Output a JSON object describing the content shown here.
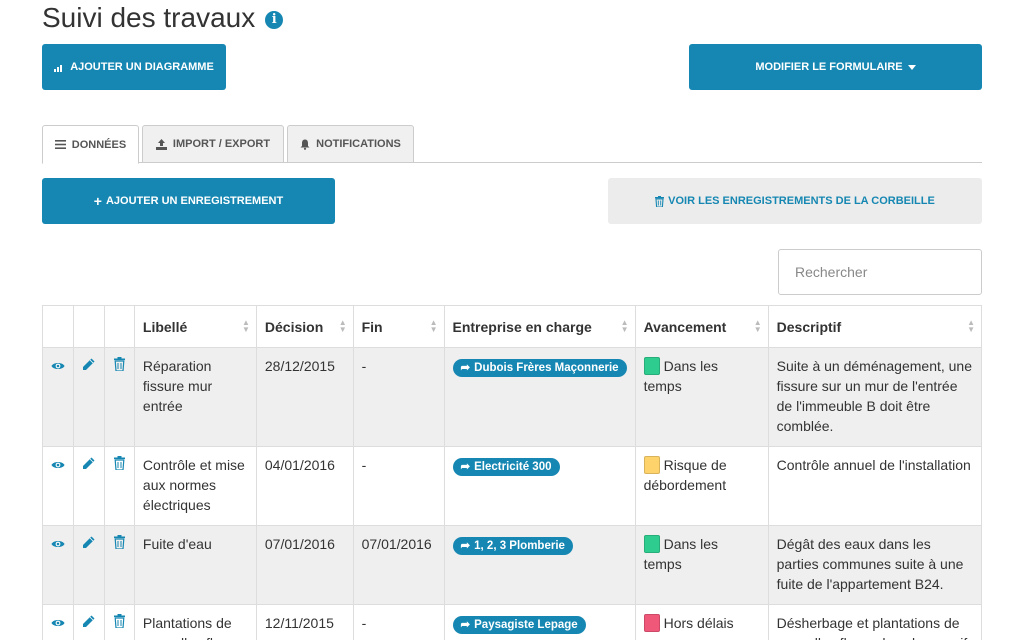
{
  "page": {
    "title": "Suivi des travaux"
  },
  "toolbar": {
    "add_chart_label": "AJOUTER UN DIAGRAMME",
    "edit_form_label": "MODIFIER LE FORMULAIRE"
  },
  "tabs": [
    {
      "label": "DONNÉES",
      "icon": "list-icon",
      "active": true
    },
    {
      "label": "IMPORT / EXPORT",
      "icon": "import-export-icon",
      "active": false
    },
    {
      "label": "NOTIFICATIONS",
      "icon": "bell-icon",
      "active": false
    }
  ],
  "actions": {
    "add_record_label": "AJOUTER UN ENREGISTREMENT",
    "trash_label": "VOIR LES ENREGISTREMENTS DE LA CORBEILLE"
  },
  "search": {
    "placeholder": "Rechercher"
  },
  "colors": {
    "accent": "#1687b2",
    "status_green": "#2ecc8f",
    "status_yellow": "#ffd36b",
    "status_red": "#f0587a"
  },
  "table": {
    "columns": [
      "Libellé",
      "Décision",
      "Fin",
      "Entreprise en charge",
      "Avancement",
      "Descriptif"
    ],
    "rows": [
      {
        "libelle": "Réparation fissure mur entrée",
        "decision": "28/12/2015",
        "fin": "-",
        "entreprise": "Dubois Frères Maçonnerie",
        "avancement": "Dans les temps",
        "status_color": "#2ecc8f",
        "descriptif": "Suite à un déménagement, une fissure sur un mur de l'entrée de l'immeuble B doit être comblée."
      },
      {
        "libelle": "Contrôle et mise aux normes électriques",
        "decision": "04/01/2016",
        "fin": "-",
        "entreprise": "Electricité 300",
        "avancement": "Risque de débordement",
        "status_color": "#ffd36b",
        "descriptif": "Contrôle annuel de l'installation"
      },
      {
        "libelle": "Fuite d'eau",
        "decision": "07/01/2016",
        "fin": "07/01/2016",
        "entreprise": "1, 2, 3 Plomberie",
        "avancement": "Dans les temps",
        "status_color": "#2ecc8f",
        "descriptif": "Dégât des eaux dans les parties communes suite à une fuite de l'appartement B24."
      },
      {
        "libelle": "Plantations de nouvelles fleurs",
        "decision": "12/11/2015",
        "fin": "-",
        "entreprise": "Paysagiste Lepage",
        "avancement": "Hors délais",
        "status_color": "#f0587a",
        "descriptif": "Désherbage et plantations de nouvelles fleurs dans le massif"
      }
    ]
  }
}
